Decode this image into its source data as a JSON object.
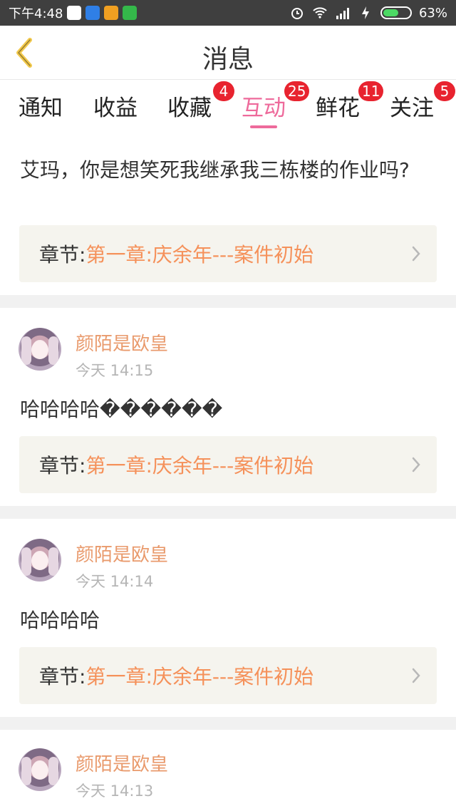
{
  "status_bar": {
    "time": "下午4:48",
    "battery_percent": "63%",
    "battery_level": 0.63
  },
  "header": {
    "title": "消息",
    "back_icon": "chevron-left-icon"
  },
  "tabs": [
    {
      "label": "通知",
      "badge": ""
    },
    {
      "label": "收益",
      "badge": ""
    },
    {
      "label": "收藏",
      "badge": "4"
    },
    {
      "label": "互动",
      "badge": "25"
    },
    {
      "label": "鲜花",
      "badge": "11"
    },
    {
      "label": "关注",
      "badge": "5"
    }
  ],
  "active_tab": "互动",
  "messages": [
    {
      "username": "",
      "timestamp": "",
      "text": "艾玛，你是想笑死我继承我三栋楼的作业吗?",
      "chapter_label": "章节:",
      "chapter_title": "第一章:庆余年---案件初始"
    },
    {
      "username": "颜陌是欧皇",
      "timestamp": "今天 14:15",
      "text": "哈哈哈哈������",
      "chapter_label": "章节:",
      "chapter_title": "第一章:庆余年---案件初始"
    },
    {
      "username": "颜陌是欧皇",
      "timestamp": "今天 14:14",
      "text": "哈哈哈哈",
      "chapter_label": "章节:",
      "chapter_title": "第一章:庆余年---案件初始"
    },
    {
      "username": "颜陌是欧皇",
      "timestamp": "今天 14:13",
      "text": "",
      "chapter_label": "",
      "chapter_title": ""
    }
  ],
  "colors": {
    "accent": "#ee6a9b",
    "badge": "#e8232f",
    "username": "#e99a6c",
    "chapter_title": "#f5915a",
    "back_icon": "#f2c94c"
  }
}
